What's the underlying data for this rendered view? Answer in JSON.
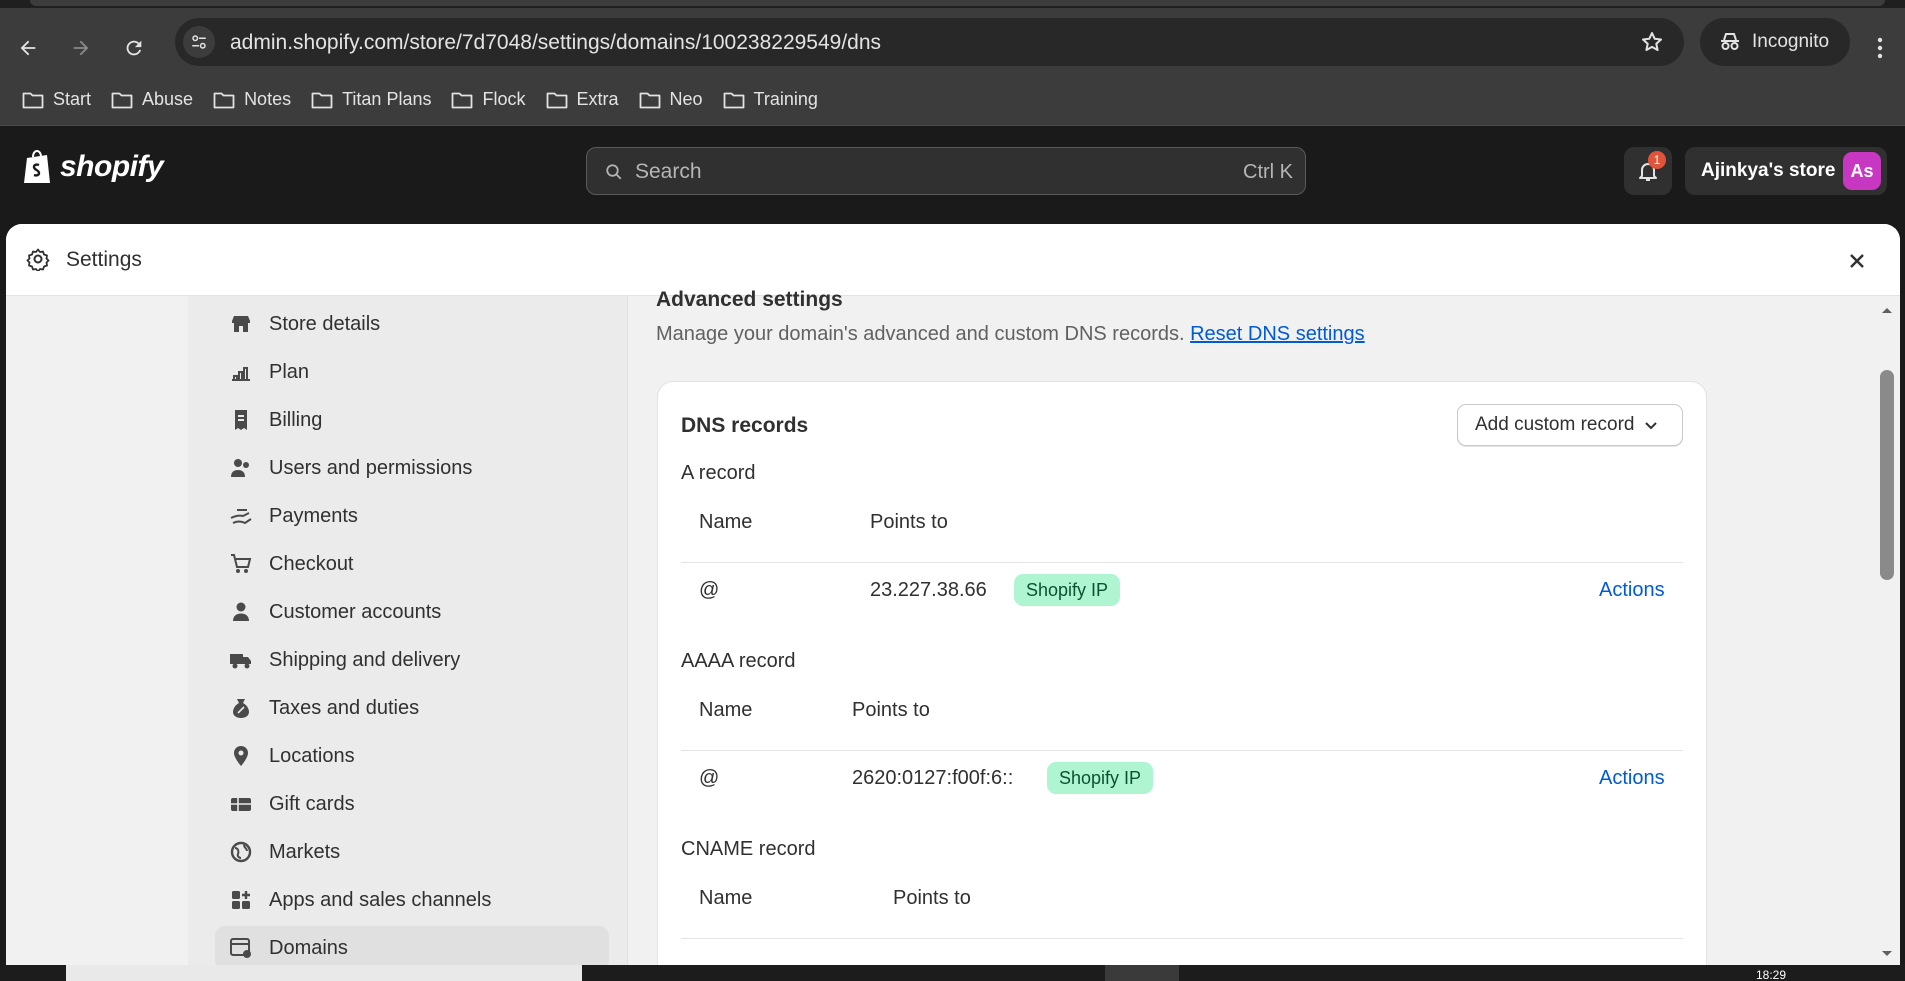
{
  "browser": {
    "url": "admin.shopify.com/store/7d7048/settings/domains/100238229549/dns",
    "incognito_label": "Incognito",
    "bookmarks": [
      "Start",
      "Abuse",
      "Notes",
      "Titan Plans",
      "Flock",
      "Extra",
      "Neo",
      "Training"
    ]
  },
  "topbar": {
    "logo_text": "shopify",
    "search_placeholder": "Search",
    "search_shortcut": "Ctrl K",
    "notification_count": "1",
    "store_name": "Ajinkya's store",
    "avatar_initials": "As",
    "avatar_color": "#c837c2"
  },
  "modal": {
    "title": "Settings"
  },
  "sidebar": {
    "items": [
      {
        "label": "Store details",
        "icon": "store-icon"
      },
      {
        "label": "Plan",
        "icon": "plan-icon"
      },
      {
        "label": "Billing",
        "icon": "billing-icon"
      },
      {
        "label": "Users and permissions",
        "icon": "users-icon"
      },
      {
        "label": "Payments",
        "icon": "payments-icon"
      },
      {
        "label": "Checkout",
        "icon": "cart-icon"
      },
      {
        "label": "Customer accounts",
        "icon": "person-icon"
      },
      {
        "label": "Shipping and delivery",
        "icon": "truck-icon"
      },
      {
        "label": "Taxes and duties",
        "icon": "tax-icon"
      },
      {
        "label": "Locations",
        "icon": "location-icon"
      },
      {
        "label": "Gift cards",
        "icon": "gift-card-icon"
      },
      {
        "label": "Markets",
        "icon": "globe-icon"
      },
      {
        "label": "Apps and sales channels",
        "icon": "apps-icon"
      },
      {
        "label": "Domains",
        "icon": "domains-icon",
        "active": true
      }
    ]
  },
  "content": {
    "section_title": "Advanced settings",
    "section_desc": "Manage your domain's advanced and custom DNS records.",
    "reset_link": "Reset DNS settings",
    "card_title": "DNS records",
    "add_button": "Add custom record",
    "records": [
      {
        "type": "A record",
        "col_name": "Name",
        "col_points": "Points to",
        "name": "@",
        "value": "23.227.38.66",
        "badge": "Shopify IP",
        "action": "Actions"
      },
      {
        "type": "AAAA record",
        "col_name": "Name",
        "col_points": "Points to",
        "name": "@",
        "value": "2620:0127:f00f:6::",
        "badge": "Shopify IP",
        "action": "Actions"
      },
      {
        "type": "CNAME record",
        "col_name": "Name",
        "col_points": "Points to"
      }
    ]
  },
  "taskbar": {
    "clock": "18:29"
  }
}
